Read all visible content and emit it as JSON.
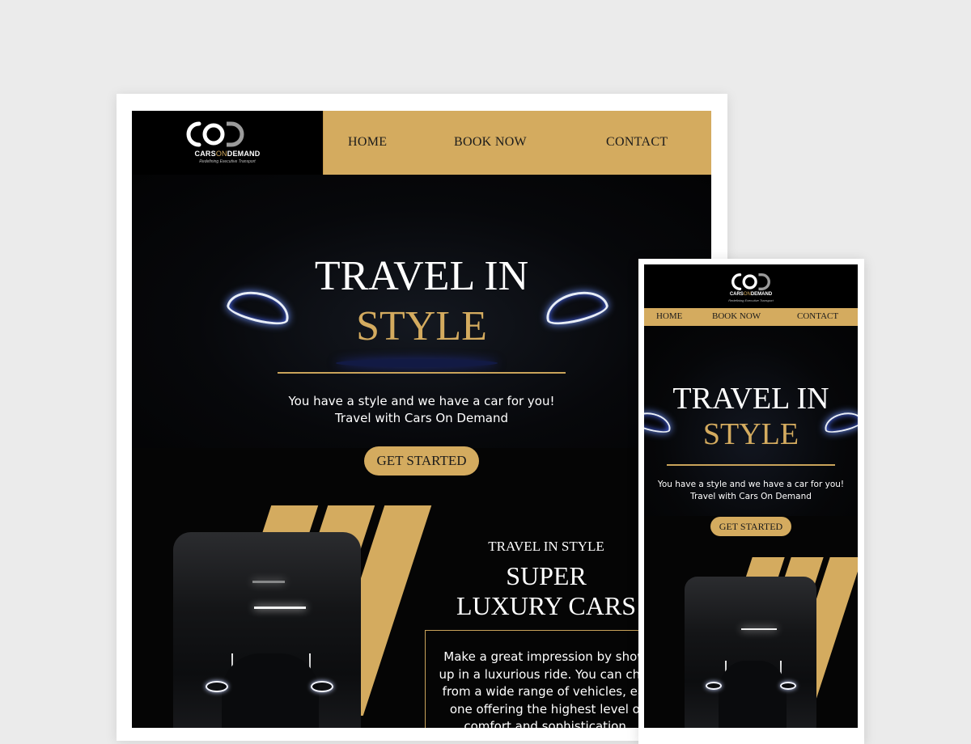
{
  "brand": {
    "logo_mark": "COD",
    "name_cars": "CARS",
    "name_on": "ON",
    "name_demand": "DEMAND",
    "tagline": "Redefining Executive Transport"
  },
  "nav": {
    "home": "HOME",
    "book": "BOOK NOW",
    "contact": "CONTACT"
  },
  "hero": {
    "title_line1": "TRAVEL IN",
    "title_line2": "STYLE",
    "subtitle_line1": "You have a style and we have a car for you!",
    "subtitle_line2": "Travel with Cars On Demand",
    "cta": "GET STARTED"
  },
  "feature": {
    "kicker": "TRAVEL IN STYLE",
    "title_line1": "SUPER",
    "title_line2": "LUXURY CARS",
    "desc_lines": [
      "Make a great impression by showi",
      "up in a luxurious ride. You can choo",
      "from a wide range of vehicles, eac",
      "one offering the highest level of",
      "comfort and sophistication."
    ]
  },
  "colors": {
    "gold": "#d4ab5f",
    "black": "#050505",
    "frame": "#ffffff",
    "backdrop": "#ebebeb"
  }
}
